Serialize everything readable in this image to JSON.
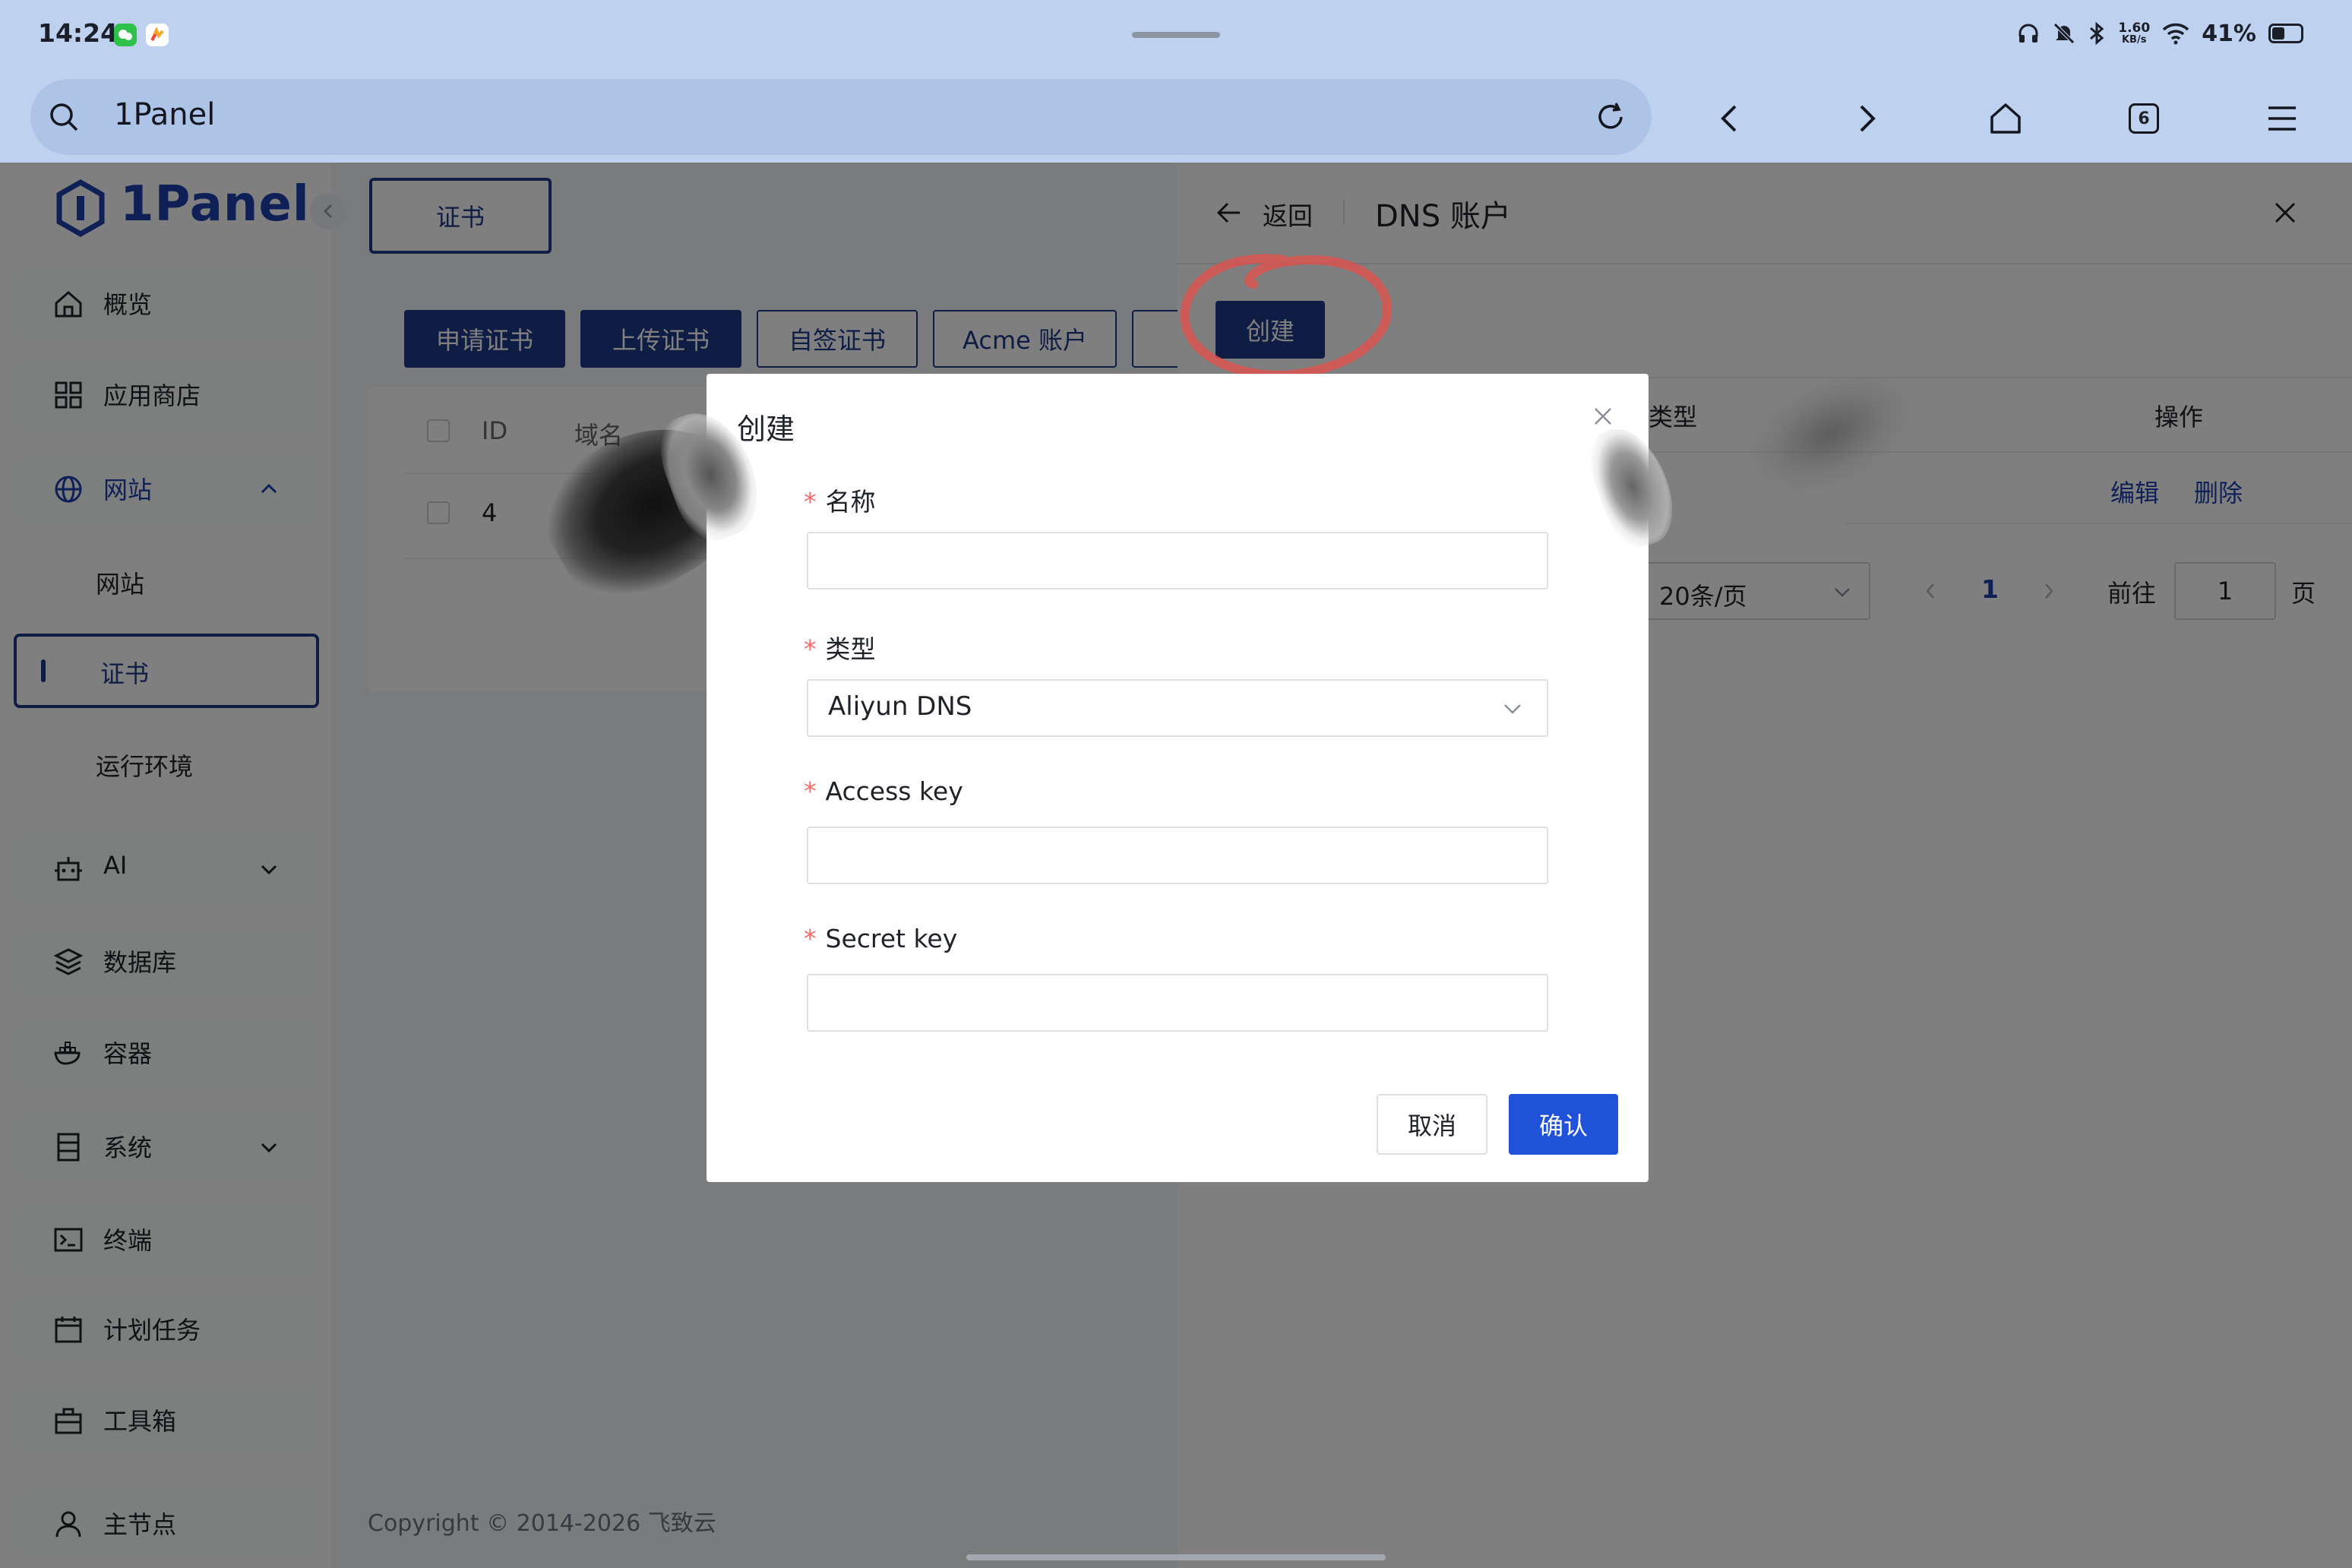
{
  "status_bar": {
    "time": "14:24",
    "net_speed_top": "1.60",
    "net_speed_unit": "KB/s",
    "battery": "41%",
    "icons": [
      "headphones-icon",
      "mute-icon",
      "bluetooth-icon",
      "wifi-icon",
      "battery-icon"
    ]
  },
  "browser": {
    "address": "1Panel",
    "tab_count": "6",
    "icons": [
      "search-icon",
      "reload-icon",
      "back-icon",
      "forward-icon",
      "home-icon",
      "tabs-icon",
      "menu-icon"
    ]
  },
  "sidebar": {
    "logo": "1Panel",
    "items": [
      {
        "label": "概览",
        "icon": "home-icon"
      },
      {
        "label": "应用商店",
        "icon": "grid-icon"
      },
      {
        "label": "网站",
        "icon": "globe-icon"
      },
      {
        "label": "网站",
        "icon": ""
      },
      {
        "label": "证书",
        "icon": ""
      },
      {
        "label": "运行环境",
        "icon": ""
      },
      {
        "label": "AI",
        "icon": "robot-icon"
      },
      {
        "label": "数据库",
        "icon": "layers-icon"
      },
      {
        "label": "容器",
        "icon": "docker-icon"
      },
      {
        "label": "系统",
        "icon": "server-icon"
      },
      {
        "label": "终端",
        "icon": "terminal-icon"
      },
      {
        "label": "计划任务",
        "icon": "calendar-icon"
      },
      {
        "label": "工具箱",
        "icon": "toolbox-icon"
      },
      {
        "label": "主节点",
        "icon": "user-icon"
      }
    ]
  },
  "main": {
    "tab": "证书",
    "buttons": [
      "申请证书",
      "上传证书",
      "自签证书",
      "Acme 账户"
    ],
    "table_headers": [
      "ID",
      "域名"
    ],
    "rows": [
      {
        "id": "4"
      }
    ],
    "copyright": "Copyright © 2014-2026 飞致云"
  },
  "drawer": {
    "back": "返回",
    "title": "DNS 账户",
    "create": "创建",
    "headers": {
      "type": "类型",
      "actions": "操作"
    },
    "row_actions": {
      "edit": "编辑",
      "delete": "删除"
    },
    "pagination": {
      "page_size": "20条/页",
      "current": "1",
      "goto_label": "前往",
      "goto_value": "1",
      "suffix": "页"
    }
  },
  "modal": {
    "title": "创建",
    "fields": [
      {
        "label": "名称",
        "value": ""
      },
      {
        "label": "类型",
        "value": "Aliyun DNS"
      },
      {
        "label": "Access key",
        "value": ""
      },
      {
        "label": "Secret key",
        "value": ""
      }
    ],
    "cancel": "取消",
    "confirm": "确认"
  },
  "colors": {
    "primary": "#1e3a8a",
    "confirm": "#1f52d8",
    "required": "#f56c6c",
    "annotation": "#d9534f"
  }
}
